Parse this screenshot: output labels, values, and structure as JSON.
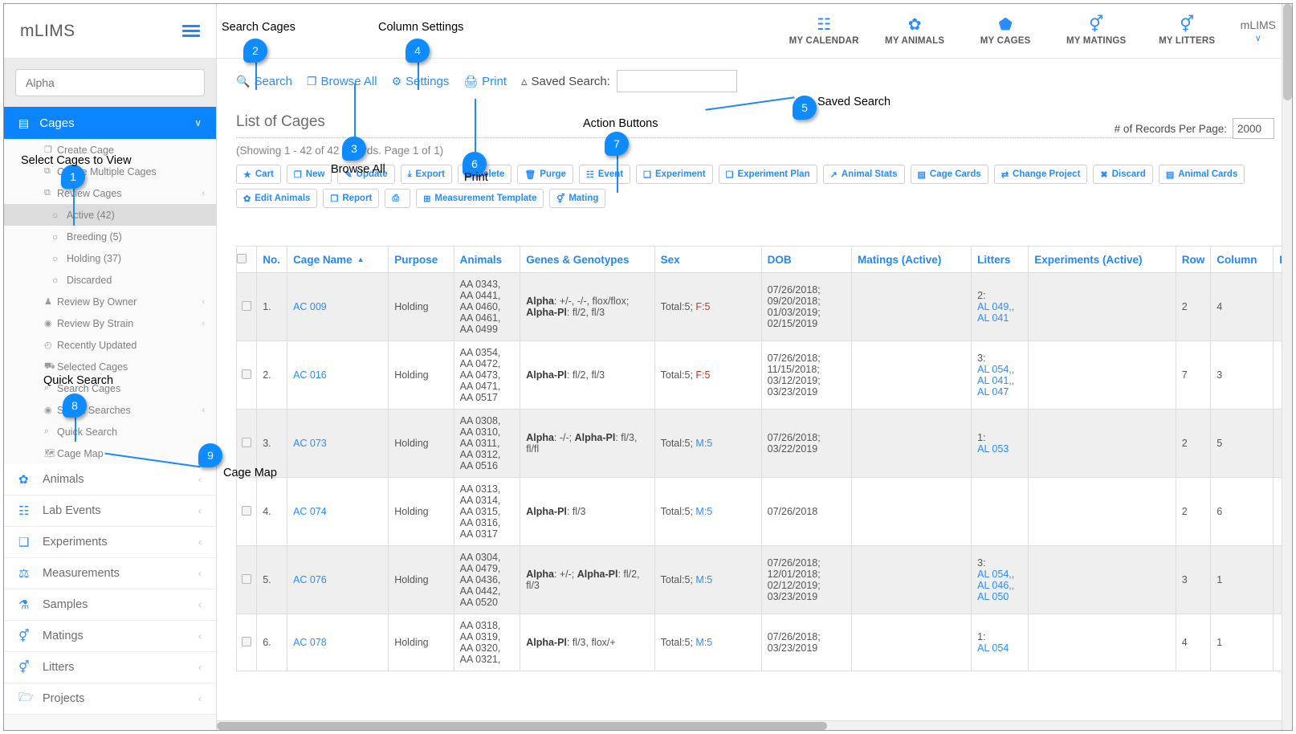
{
  "brand": {
    "name": "mLIMS",
    "menu_icon": "hamburger-icon"
  },
  "sidebar": {
    "search_placeholder": "Alpha",
    "section": {
      "label": "Cages",
      "icon": "cube-icon",
      "chevron": "∨"
    },
    "cages_items": [
      {
        "label": "Create Cage",
        "icon": "file-icon",
        "type": "plain"
      },
      {
        "label": "Create Multiple Cages",
        "icon": "copy-icon",
        "type": "plain"
      },
      {
        "label": "Review Cages",
        "icon": "copy-icon",
        "type": "plain",
        "chevron": "‹"
      },
      {
        "label": "Active (42)",
        "icon": "radio-icon",
        "type": "radio",
        "active": true
      },
      {
        "label": "Breeding (5)",
        "icon": "radio-icon",
        "type": "radio"
      },
      {
        "label": "Holding (37)",
        "icon": "radio-icon",
        "type": "radio"
      },
      {
        "label": "Discarded",
        "icon": "radio-icon",
        "type": "radio"
      },
      {
        "label": "Review By Owner",
        "icon": "user-icon",
        "type": "plain",
        "chevron": "‹"
      },
      {
        "label": "Review By Strain",
        "icon": "target-icon",
        "type": "plain",
        "chevron": "‹"
      },
      {
        "label": "Recently Updated",
        "icon": "clock-icon",
        "type": "plain"
      },
      {
        "label": "Selected Cages",
        "icon": "cart-icon",
        "type": "plain"
      },
      {
        "label": "Search Cages",
        "icon": "search-icon",
        "type": "plain"
      },
      {
        "label": "Saved Searches",
        "icon": "target-icon",
        "type": "plain",
        "chevron": "‹"
      },
      {
        "label": "Quick Search",
        "icon": "search-plus-icon",
        "type": "plain"
      },
      {
        "label": "Cage Map",
        "icon": "map-icon",
        "type": "plain"
      }
    ],
    "main_items": [
      {
        "label": "Animals",
        "icon": "paw-icon"
      },
      {
        "label": "Lab Events",
        "icon": "calendar-icon"
      },
      {
        "label": "Experiments",
        "icon": "flask-doc-icon"
      },
      {
        "label": "Measurements",
        "icon": "scale-icon"
      },
      {
        "label": "Samples",
        "icon": "flask-icon"
      },
      {
        "label": "Matings",
        "icon": "mating-icon"
      },
      {
        "label": "Litters",
        "icon": "litter-icon"
      },
      {
        "label": "Projects",
        "icon": "folder-icon"
      }
    ]
  },
  "topnav": {
    "items": [
      {
        "label": "MY CALENDAR",
        "icon": "calendar-icon",
        "glyph": "Ὄ5"
      },
      {
        "label": "MY ANIMALS",
        "icon": "paw-icon"
      },
      {
        "label": "MY CAGES",
        "icon": "cube-icon"
      },
      {
        "label": "MY MATINGS",
        "icon": "mating-icon"
      },
      {
        "label": "MY LITTERS",
        "icon": "litter-icon"
      }
    ],
    "user": {
      "name": "mLIMS",
      "chevron": "∨"
    }
  },
  "toolbar": {
    "search": "Search",
    "browse_all": "Browse All",
    "settings": "Settings",
    "print": "Print",
    "saved_search_label": "Saved Search:",
    "saved_search_value": "",
    "records_per_page_label": "# of Records Per Page:",
    "records_per_page_value": "2000"
  },
  "page": {
    "title": "List of Cages",
    "showing": "(Showing 1 - 42 of 42 records. Page 1 of 1)"
  },
  "action_buttons": [
    {
      "label": "Cart",
      "icon": "star-icon"
    },
    {
      "label": "New",
      "icon": "file-icon"
    },
    {
      "label": "Update",
      "icon": "edit-icon"
    },
    {
      "label": "Export",
      "icon": "download-icon"
    },
    {
      "label": "Delete",
      "icon": "recycle-icon"
    },
    {
      "label": "Purge",
      "icon": "trash-icon"
    },
    {
      "label": "Event",
      "icon": "calendar-icon"
    },
    {
      "label": "Experiment",
      "icon": "doc-icon"
    },
    {
      "label": "Experiment Plan",
      "icon": "doc-icon"
    },
    {
      "label": "Animal Stats",
      "icon": "chart-icon"
    },
    {
      "label": "Cage Cards",
      "icon": "card-icon"
    },
    {
      "label": "Change Project",
      "icon": "exchange-icon"
    },
    {
      "label": "Discard",
      "icon": "x-icon"
    },
    {
      "label": "Animal Cards",
      "icon": "card-icon"
    },
    {
      "label": "Edit Animals",
      "icon": "paw-icon"
    },
    {
      "label": "Report",
      "icon": "report-icon"
    },
    {
      "label": "",
      "icon": "printer-icon"
    },
    {
      "label": "Measurement Template",
      "icon": "grid-icon"
    },
    {
      "label": "Mating",
      "icon": "mating-icon"
    }
  ],
  "table": {
    "columns": [
      "No.",
      "Cage Name",
      "Purpose",
      "Animals",
      "Genes & Genotypes",
      "Sex",
      "DOB",
      "Matings (Active)",
      "Litters",
      "Experiments (Active)",
      "Row",
      "Column",
      "Experiment S"
    ],
    "sorted_column": "Cage Name",
    "sort_dir": "▲",
    "rows": [
      {
        "no": "1.",
        "cage": "AC 009",
        "purpose": "Holding",
        "animals": [
          "AA 0343,",
          "AA 0441,",
          "AA 0460,",
          "AA 0461,",
          "AA 0499"
        ],
        "animals_color": "red",
        "genes": "Alpha: +/-, -/-, flox/flox; Alpha-Pl: fl/2, fl/3",
        "sex_total": "Total:5;",
        "sex_split": "F:5",
        "sex_color": "red",
        "dob": [
          "07/26/2018;",
          "09/20/2018;",
          "01/03/2019;",
          "02/15/2019"
        ],
        "matings": "",
        "litters_count": "2:",
        "litters": [
          "AL 049,",
          "AL 041"
        ],
        "experiments": "",
        "row": "2",
        "column": "4",
        "exp_s": ""
      },
      {
        "no": "2.",
        "cage": "AC 016",
        "purpose": "Holding",
        "animals": [
          "AA 0354,",
          "AA 0472,",
          "AA 0473,",
          "AA 0471,",
          "AA 0517"
        ],
        "animals_color": "red",
        "genes": "Alpha-Pl: fl/2, fl/3",
        "sex_total": "Total:5;",
        "sex_split": "F:5",
        "sex_color": "red",
        "dob": [
          "07/26/2018;",
          "11/15/2018;",
          "03/12/2019;",
          "03/23/2019"
        ],
        "matings": "",
        "litters_count": "3:",
        "litters": [
          "AL 054,",
          "AL 041,",
          "AL 047"
        ],
        "experiments": "",
        "row": "7",
        "column": "3",
        "exp_s": ""
      },
      {
        "no": "3.",
        "cage": "AC 073",
        "purpose": "Holding",
        "animals": [
          "AA 0308,",
          "AA 0310,",
          "AA 0311,",
          "AA 0312,",
          "AA 0516"
        ],
        "animals_color": "blue",
        "genes": "Alpha: -/-; Alpha-Pl: fl/3, fl/fl",
        "sex_total": "Total:5;",
        "sex_split": "M:5",
        "sex_color": "blue",
        "dob": [
          "07/26/2018;",
          "03/22/2019"
        ],
        "matings": "",
        "litters_count": "1:",
        "litters": [
          "AL 053"
        ],
        "experiments": "",
        "row": "2",
        "column": "5",
        "exp_s": ""
      },
      {
        "no": "4.",
        "cage": "AC 074",
        "purpose": "Holding",
        "animals": [
          "AA 0313,",
          "AA 0314,",
          "AA 0315,",
          "AA 0316,",
          "AA 0317"
        ],
        "animals_color": "blue",
        "genes": "Alpha-Pl: fl/3",
        "sex_total": "Total:5;",
        "sex_split": "M:5",
        "sex_color": "blue",
        "dob": [
          "07/26/2018"
        ],
        "matings": "",
        "litters_count": "",
        "litters": [],
        "experiments": "",
        "row": "2",
        "column": "6",
        "exp_s": ""
      },
      {
        "no": "5.",
        "cage": "AC 076",
        "purpose": "Holding",
        "animals": [
          "AA 0304,",
          "AA 0479,",
          "AA 0436,",
          "AA 0442,",
          "AA 0520"
        ],
        "animals_color": "blue",
        "genes": "Alpha: +/-; Alpha-Pl: fl/2, fl/3",
        "sex_total": "Total:5;",
        "sex_split": "M:5",
        "sex_color": "blue",
        "dob": [
          "07/26/2018;",
          "12/01/2018;",
          "02/12/2019;",
          "03/23/2019"
        ],
        "matings": "",
        "litters_count": "3:",
        "litters": [
          "AL 054,",
          "AL 046,",
          "AL 050"
        ],
        "experiments": "",
        "row": "3",
        "column": "1",
        "exp_s": ""
      },
      {
        "no": "6.",
        "cage": "AC 078",
        "purpose": "Holding",
        "animals": [
          "AA 0318,",
          "AA 0319,",
          "AA 0320,",
          "AA 0321,"
        ],
        "animals_color": "blue",
        "genes": "Alpha-Pl: fl/3, flox/+",
        "sex_total": "Total:5;",
        "sex_split": "M:5",
        "sex_color": "blue",
        "dob": [
          "07/26/2018;",
          "03/23/2019"
        ],
        "matings": "",
        "litters_count": "1:",
        "litters": [
          "AL 054"
        ],
        "experiments": "",
        "row": "4",
        "column": "1",
        "exp_s": ""
      }
    ]
  },
  "callouts": [
    {
      "n": "1",
      "label": "Select Cages to View"
    },
    {
      "n": "2",
      "label": "Search Cages"
    },
    {
      "n": "3",
      "label": "Browse All"
    },
    {
      "n": "4",
      "label": "Column Settings"
    },
    {
      "n": "5",
      "label": "Saved Search"
    },
    {
      "n": "6",
      "label": "Print"
    },
    {
      "n": "7",
      "label": "Action Buttons"
    },
    {
      "n": "8",
      "label": "Quick Search"
    },
    {
      "n": "9",
      "label": "Cage Map"
    }
  ],
  "colors": {
    "accent": "#0a84ff",
    "link": "#2b8cff",
    "red": "#c0392b"
  }
}
